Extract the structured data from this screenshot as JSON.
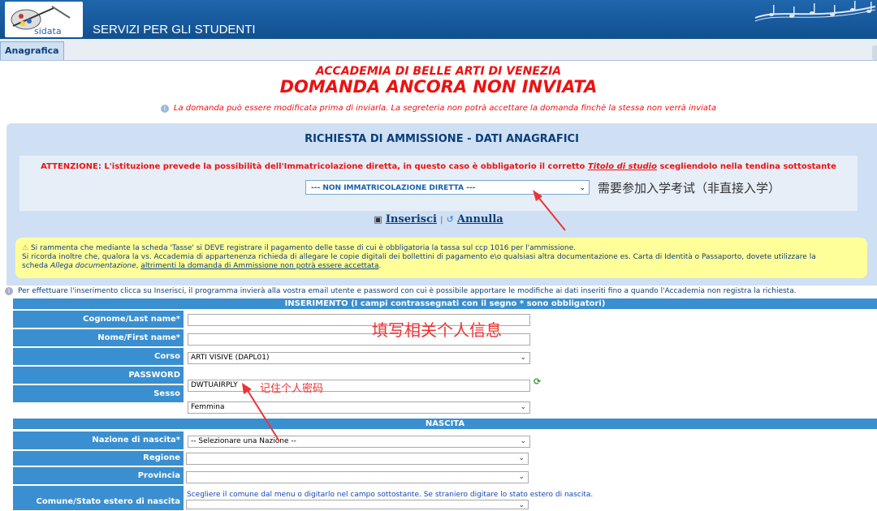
{
  "header": {
    "logo_text": "sidata",
    "app_title": "SERVIZI PER GLI STUDENTI"
  },
  "tabs": [
    {
      "label": "Anagrafica"
    }
  ],
  "page": {
    "institution": "ACCADEMIA DI BELLE ARTI DI VENEZIA",
    "status": "DOMANDA ANCORA NON INVIATA",
    "note": "La domanda può essere modificata prima di inviarla. La segreteria non potrà accettare la domanda finchè la stessa non verrà inviata"
  },
  "panel": {
    "title": "RICHIESTA DI AMMISSIONE - DATI ANAGRAFICI",
    "warning_pre": "ATTENZIONE: L'istituzione prevede la possibilità dell'Immatricolazione diretta, in questo caso è obbligatorio il corretto ",
    "warning_link": "Titolo di studio",
    "warning_post": " scegliendolo nella tendina sottostante",
    "admission_select": "--- NON IMMATRICOLAZIONE DIRETTA ---",
    "annotation": "需要参加入学考试（非直接入学）"
  },
  "actions": {
    "insert_label": "Inserisci",
    "separator": "|",
    "cancel_label": "Annulla"
  },
  "notice": {
    "line1": "Si rammenta che mediante la scheda 'Tasse' si DEVE registrare il pagamento delle tasse di cui è obbligatoria la tassa sul ccp 1016 per l'ammissione.",
    "line2": "Si ricorda inoltre che, qualora la vs. Accademia di appartenenza richieda di allegare le copie digitali dei bollettini di pagamento e\\o qualsiasi altra documentazione es. Carta di Identità o Passaporto, dovete utilizzare la",
    "line3_pre": "scheda ",
    "line3_italic": "Allega documentazione",
    "line3_mid": ", ",
    "line3_link": "altrimenti la domanda di Ammissione non potrà essere accettata",
    "line3_post": "."
  },
  "instructions": "Per effettuare l'inserimento clicca su Inserisci, il programma invierà alla vostra email utente e password con cui è possibile apportare le modifiche ai dati inseriti fino a quando l'Accademia non registra la richiesta.",
  "form": {
    "section_insert": "INSERIMENTO (I campi contrassegnati con il segno * sono obbligatori)",
    "labels": {
      "cognome": "Cognome/Last name*",
      "nome": "Nome/First name*",
      "corso": "Corso",
      "password": "PASSWORD",
      "sesso": "Sesso",
      "nazione": "Nazione di nascita*",
      "regione": "Regione",
      "provincia": "Provincia",
      "comune": "Comune/Stato estero di nascita"
    },
    "values": {
      "cognome": "",
      "nome": "",
      "corso": "ARTI VISIVE (DAPL01)",
      "password": "DWTUAIRPLY",
      "sesso": "Femmina",
      "nazione": "-- Selezionare una Nazione --",
      "regione": "",
      "provincia": "",
      "comune": ""
    },
    "section_birth": "NASCITA",
    "comune_hint": "Scegliere il comune dal menu o digitarlo nel campo sottostante. Se straniero digitare lo stato estero di nascita.",
    "annotation_personal": "填写相关个人信息",
    "annotation_password": "记住个人密码"
  },
  "colors": {
    "header_blue": "#11508f",
    "label_blue": "#3a8fd0",
    "alert_red": "#ee1111",
    "notice_yellow": "#ffff9a"
  }
}
